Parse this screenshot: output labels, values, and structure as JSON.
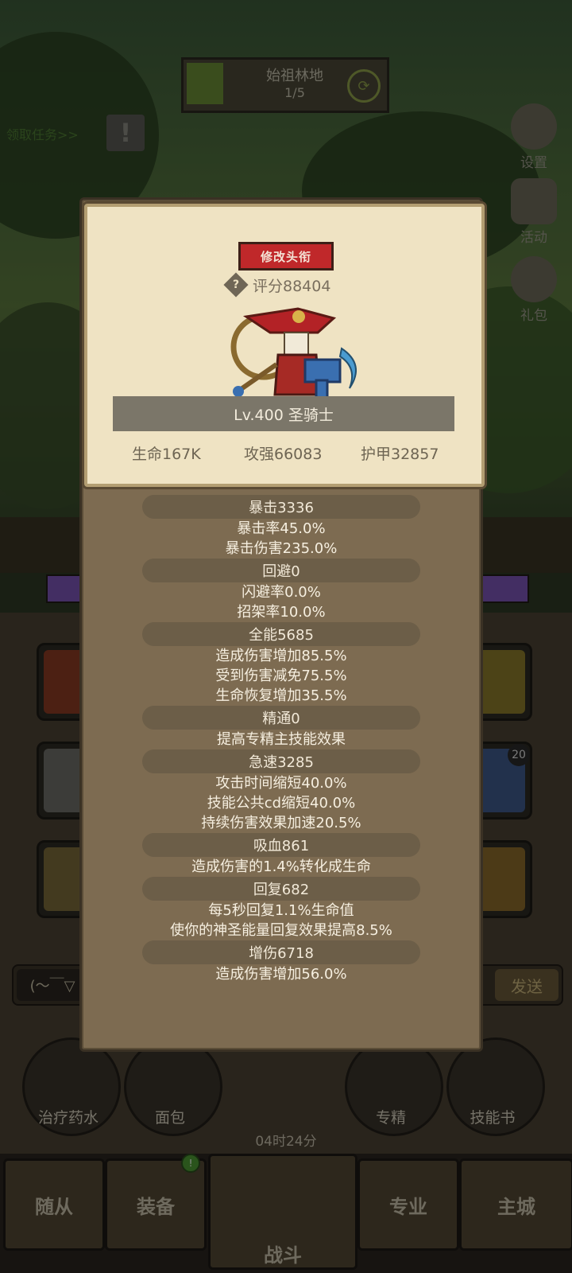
{
  "location": {
    "name": "始祖林地",
    "progress": "1/5"
  },
  "quest": {
    "link": "领取任务>>"
  },
  "side_menu": [
    {
      "label": "设置"
    },
    {
      "label": "活动"
    },
    {
      "label": "礼包"
    }
  ],
  "chat": {
    "left": "(～￣▽",
    "send": "发送"
  },
  "slot_badge": "20",
  "bottom_buttons": [
    {
      "label": "治疗药水"
    },
    {
      "label": "面包"
    },
    {
      "label": "专精"
    },
    {
      "label": "技能书"
    }
  ],
  "timer": "04时24分",
  "nav": {
    "items": [
      "随从",
      "装备",
      "战斗",
      "专业",
      "主城"
    ],
    "notification": "!"
  },
  "panel": {
    "rename_button": "修改头衔",
    "score": "评分88404",
    "class_line": "Lv.400 圣骑士",
    "main_stats": [
      "生命167K",
      "攻强66083",
      "护甲32857"
    ],
    "stats": [
      {
        "title": "暴击3336",
        "lines": [
          "暴击率45.0%",
          "暴击伤害235.0%"
        ]
      },
      {
        "title": "回避0",
        "lines": [
          "闪避率0.0%",
          "招架率10.0%"
        ]
      },
      {
        "title": "全能5685",
        "lines": [
          "造成伤害增加85.5%",
          "受到伤害减免75.5%",
          "生命恢复增加35.5%"
        ]
      },
      {
        "title": "精通0",
        "lines": [
          "提高专精主技能效果"
        ]
      },
      {
        "title": "急速3285",
        "lines": [
          "攻击时间缩短40.0%",
          "技能公共cd缩短40.0%",
          "持续伤害效果加速20.5%"
        ]
      },
      {
        "title": "吸血861",
        "lines": [
          "造成伤害的1.4%转化成生命"
        ]
      },
      {
        "title": "回复682",
        "lines": [
          "每5秒回复1.1%生命值",
          "使你的神圣能量回复效果提高8.5%"
        ]
      },
      {
        "title": "增伤6718",
        "lines": [
          "造成伤害增加56.0%"
        ]
      }
    ]
  },
  "colors": {
    "modal_body": "#7d6b51",
    "card": "#efe3c3",
    "rename_red": "#c0282a",
    "stat_pill": "#6c5e48"
  }
}
